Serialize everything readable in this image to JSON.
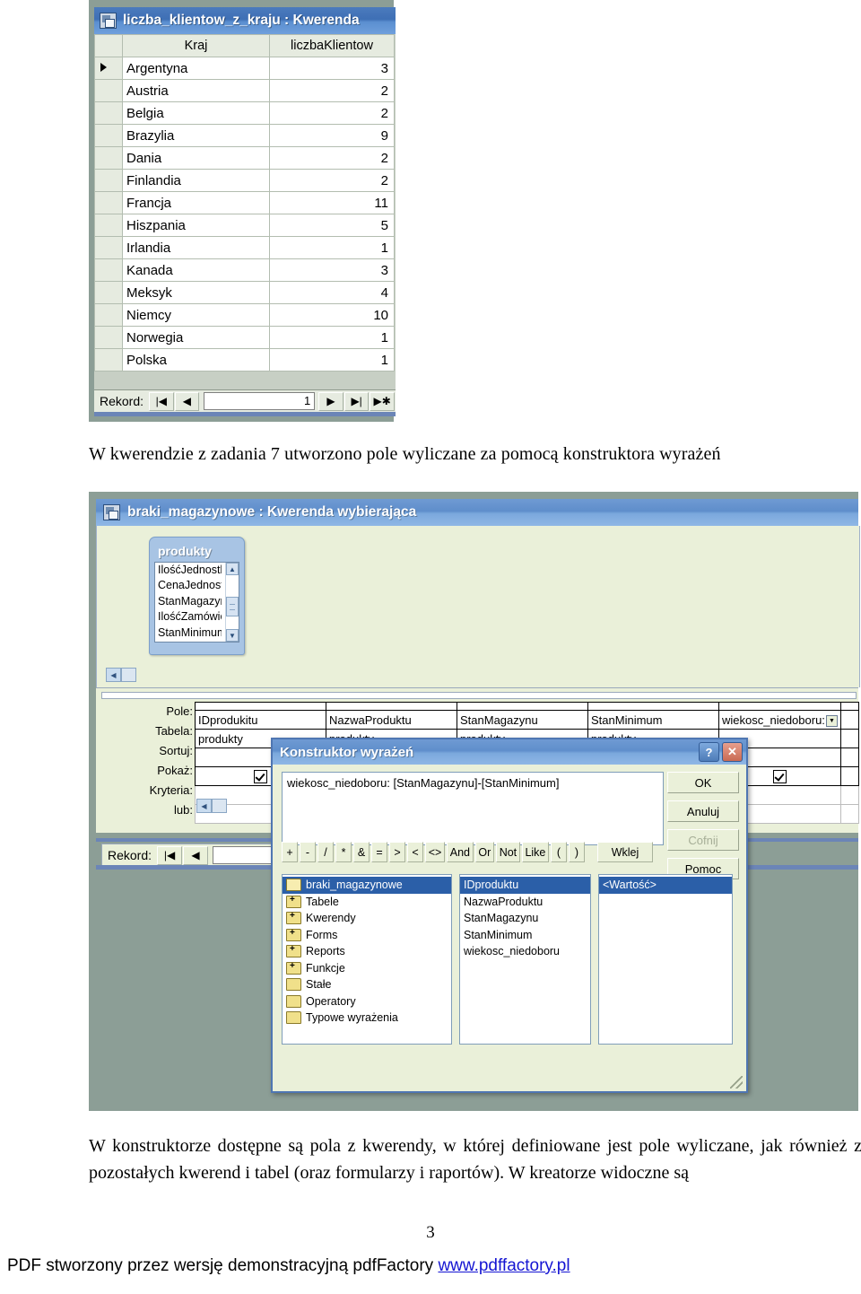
{
  "datasheet_window": {
    "title": "liczba_klientow_z_kraju : Kwerenda",
    "icon": "query-datasheet-icon",
    "columns": [
      "Kraj",
      "liczbaKlientow"
    ],
    "rows": [
      {
        "kraj": "Argentyna",
        "liczba": "3",
        "current": true
      },
      {
        "kraj": "Austria",
        "liczba": "2",
        "current": false
      },
      {
        "kraj": "Belgia",
        "liczba": "2",
        "current": false
      },
      {
        "kraj": "Brazylia",
        "liczba": "9",
        "current": false
      },
      {
        "kraj": "Dania",
        "liczba": "2",
        "current": false
      },
      {
        "kraj": "Finlandia",
        "liczba": "2",
        "current": false
      },
      {
        "kraj": "Francja",
        "liczba": "11",
        "current": false
      },
      {
        "kraj": "Hiszpania",
        "liczba": "5",
        "current": false
      },
      {
        "kraj": "Irlandia",
        "liczba": "1",
        "current": false
      },
      {
        "kraj": "Kanada",
        "liczba": "3",
        "current": false
      },
      {
        "kraj": "Meksyk",
        "liczba": "4",
        "current": false
      },
      {
        "kraj": "Niemcy",
        "liczba": "10",
        "current": false
      },
      {
        "kraj": "Norwegia",
        "liczba": "1",
        "current": false
      },
      {
        "kraj": "Polska",
        "liczba": "1",
        "current": false
      }
    ],
    "nav": {
      "label": "Rekord:",
      "first": "|◀",
      "prev": "◀",
      "value": "1",
      "next": "▶",
      "last": "▶|",
      "new": "▶✱"
    }
  },
  "caption_1": "W kwerendzie z zadania 7 utworzono pole wyliczane za pomocą konstruktora wyrażeń",
  "design_window": {
    "title": "braki_magazynowe : Kwerenda wybierająca",
    "icon": "query-design-icon",
    "table_box": {
      "name": "produkty",
      "fields": [
        "IlośćJednostk",
        "CenaJednostk",
        "StanMagazyn",
        "IlośćZamówion",
        "StanMinimum"
      ],
      "scroll_up": "▲",
      "scroll_down": "▼"
    },
    "grid": {
      "row_labels": [
        "Pole:",
        "Tabela:",
        "Sortuj:",
        "Pokaż:",
        "Kryteria:",
        "lub:"
      ],
      "columns": [
        {
          "pole": "IDprodukitu",
          "tabela": "produkty",
          "sortuj": "",
          "pokaz": true,
          "kryteria": "",
          "lub": ""
        },
        {
          "pole": "NazwaProduktu",
          "tabela": "produkty",
          "sortuj": "",
          "pokaz": true,
          "kryteria": "",
          "lub": ""
        },
        {
          "pole": "StanMagazynu",
          "tabela": "produkty",
          "sortuj": "",
          "pokaz": true,
          "kryteria": "",
          "lub": ""
        },
        {
          "pole": "StanMinimum",
          "tabela": "produkty",
          "sortuj": "",
          "pokaz": true,
          "kryteria": "",
          "lub": ""
        },
        {
          "pole": "wiekosc_niedoboru:",
          "tabela": "",
          "sortuj": "",
          "pokaz": true,
          "kryteria": "",
          "lub": "",
          "dropdown": true
        }
      ]
    },
    "nav": {
      "label": "Rekord:",
      "first": "|◀",
      "prev": "◀",
      "value": ""
    }
  },
  "expression_builder": {
    "title": "Konstruktor wyrażeń",
    "help_button": "?",
    "close_button": "✕",
    "expression": "wiekosc_niedoboru: [StanMagazynu]-[StanMinimum]",
    "operator_buttons": [
      "+",
      "-",
      "/",
      "*",
      "&",
      "=",
      ">",
      "<",
      "<>",
      "And",
      "Or",
      "Not",
      "Like",
      "(",
      ")"
    ],
    "paste_button": "Wklej",
    "buttons": {
      "ok": "OK",
      "cancel": "Anuluj",
      "undo": "Cofnij",
      "help": "Pomoc"
    },
    "tree": [
      {
        "label": "braki_magazynowe",
        "icon": "folder-open-icon",
        "selected": true
      },
      {
        "label": "Tabele",
        "icon": "folder-plus-icon",
        "selected": false
      },
      {
        "label": "Kwerendy",
        "icon": "folder-plus-icon",
        "selected": false
      },
      {
        "label": "Forms",
        "icon": "folder-plus-icon",
        "selected": false
      },
      {
        "label": "Reports",
        "icon": "folder-plus-icon",
        "selected": false
      },
      {
        "label": "Funkcje",
        "icon": "folder-plus-icon",
        "selected": false
      },
      {
        "label": "Stałe",
        "icon": "folder-icon",
        "selected": false
      },
      {
        "label": "Operatory",
        "icon": "folder-icon",
        "selected": false
      },
      {
        "label": "Typowe wyrażenia",
        "icon": "folder-icon",
        "selected": false
      }
    ],
    "fields": [
      {
        "label": "IDproduktu",
        "selected": true
      },
      {
        "label": "NazwaProduktu",
        "selected": false
      },
      {
        "label": "StanMagazynu",
        "selected": false
      },
      {
        "label": "StanMinimum",
        "selected": false
      },
      {
        "label": "wiekosc_niedoboru",
        "selected": false
      }
    ],
    "values": [
      {
        "label": "<Wartość>",
        "selected": true
      }
    ]
  },
  "caption_2": "W konstruktorze dostępne są pola z kwerendy, w której definiowane jest pole wyliczane, jak również z pozostałych kwerend i tabel (oraz formularzy i raportów). W kreatorze widoczne są",
  "page_number": "3",
  "footer": {
    "text": "PDF stworzony przez wersję demonstracyjną pdfFactory ",
    "link": "www.pdffactory.pl"
  }
}
